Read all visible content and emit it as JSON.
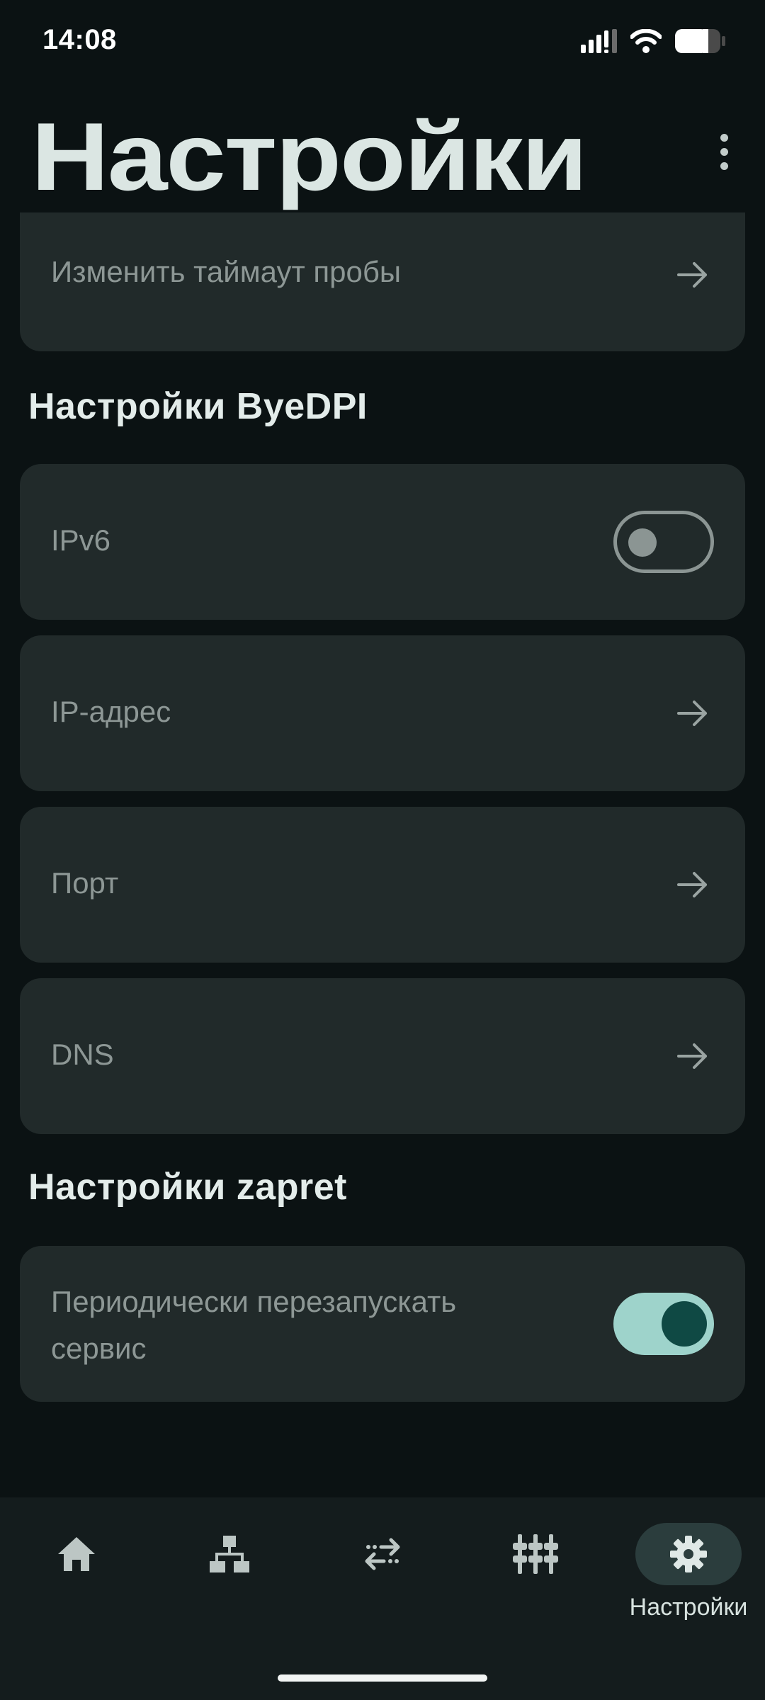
{
  "status_bar": {
    "time": "14:08",
    "icons": [
      "signal-icon",
      "wifi-icon",
      "battery-icon"
    ]
  },
  "header": {
    "title": "Настройки",
    "menu_icon": "more-vert-icon"
  },
  "probe_card": {
    "label": "Изменить таймаут пробы"
  },
  "byedpi_section": {
    "title": "Настройки ByeDPI",
    "items": [
      {
        "label": "IPv6",
        "type": "switch",
        "checked": false
      },
      {
        "label": "IP-адрес",
        "type": "link"
      },
      {
        "label": "Порт",
        "type": "link"
      },
      {
        "label": "DNS",
        "type": "link"
      }
    ]
  },
  "zapret_section": {
    "title": "Настройки zapret",
    "items": [
      {
        "label_line1": "Периодически перезапускать",
        "label_line2": "сервис",
        "type": "switch",
        "checked": true
      }
    ]
  },
  "bottom_nav": {
    "items": [
      {
        "icon": "home-icon",
        "label": ""
      },
      {
        "icon": "network-icon",
        "label": ""
      },
      {
        "icon": "swap-arrows-icon",
        "label": ""
      },
      {
        "icon": "equalizer-icon",
        "label": ""
      },
      {
        "icon": "gear-icon",
        "label": "Настройки",
        "active": true
      }
    ]
  },
  "colors": {
    "background": "#0b1213",
    "card": "#212a2a",
    "accent": "#9ed3cb",
    "accent_knob": "#0f4944"
  }
}
